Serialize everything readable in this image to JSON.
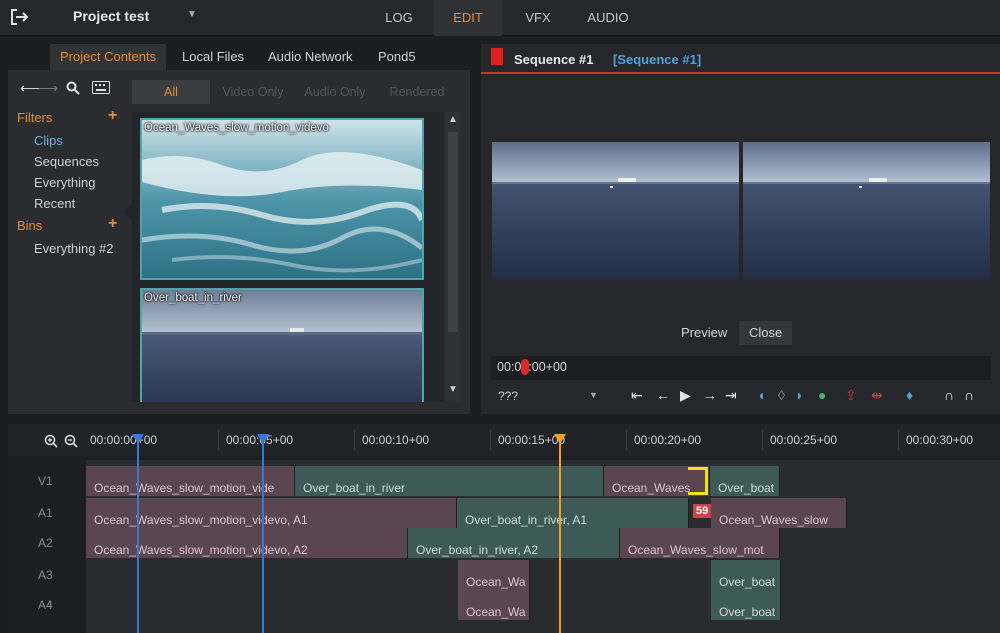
{
  "topbar": {
    "exit_icon": "exit-icon",
    "project_title": "Project test",
    "tabs": [
      {
        "label": "LOG",
        "active": false
      },
      {
        "label": "EDIT",
        "active": true
      },
      {
        "label": "VFX",
        "active": false
      },
      {
        "label": "AUDIO",
        "active": false
      }
    ],
    "accent_color": "#e98b35"
  },
  "left": {
    "tabs": [
      "Project Contents",
      "Local Files",
      "Audio Network",
      "Pond5"
    ],
    "filters_label": "Filters",
    "filters": [
      "Clips",
      "Sequences",
      "Everything",
      "Recent"
    ],
    "bins_label": "Bins",
    "bins": [
      "Everything #2"
    ],
    "subtabs": [
      "All",
      "Video Only",
      "Audio Only",
      "Rendered"
    ],
    "clips": [
      {
        "name": "Ocean_Waves_slow_motion_videvo"
      },
      {
        "name": "Over_boat_in_river"
      }
    ]
  },
  "viewer": {
    "sequence_title": "Sequence #1",
    "sequence_sub": "[Sequence #1]",
    "preview_label": "Preview",
    "close_label": "Close",
    "timecode": "00:00:00+00",
    "unknown_select": "???"
  },
  "timeline": {
    "ticks": [
      "00:00:00+00",
      "00:00:05+00",
      "00:00:10+00",
      "00:00:15+00",
      "00:00:20+00",
      "00:00:25+00",
      "00:00:30+00"
    ],
    "tracks": [
      "V1",
      "A1",
      "A2",
      "A3",
      "A4"
    ],
    "clips": {
      "v1": [
        "Ocean_Waves_slow_motion_vide",
        "Over_boat_in_river",
        "Ocean_Waves",
        "Over_boat"
      ],
      "a1": [
        "Ocean_Waves_slow_motion_videvo, A1",
        "Over_boat_in_river, A1",
        "Ocean_Waves_slow"
      ],
      "a2": [
        "Ocean_Waves_slow_motion_videvo, A2",
        "Over_boat_in_river, A2",
        "Ocean_Waves_slow_mot"
      ],
      "a3": [
        "Ocean_Wa",
        "Over_boat"
      ],
      "a4": [
        "Ocean_Wa",
        "Over_boat"
      ]
    },
    "badge": "59",
    "playhead_color": "#f0a020",
    "marker_color": "#3a78d8"
  }
}
